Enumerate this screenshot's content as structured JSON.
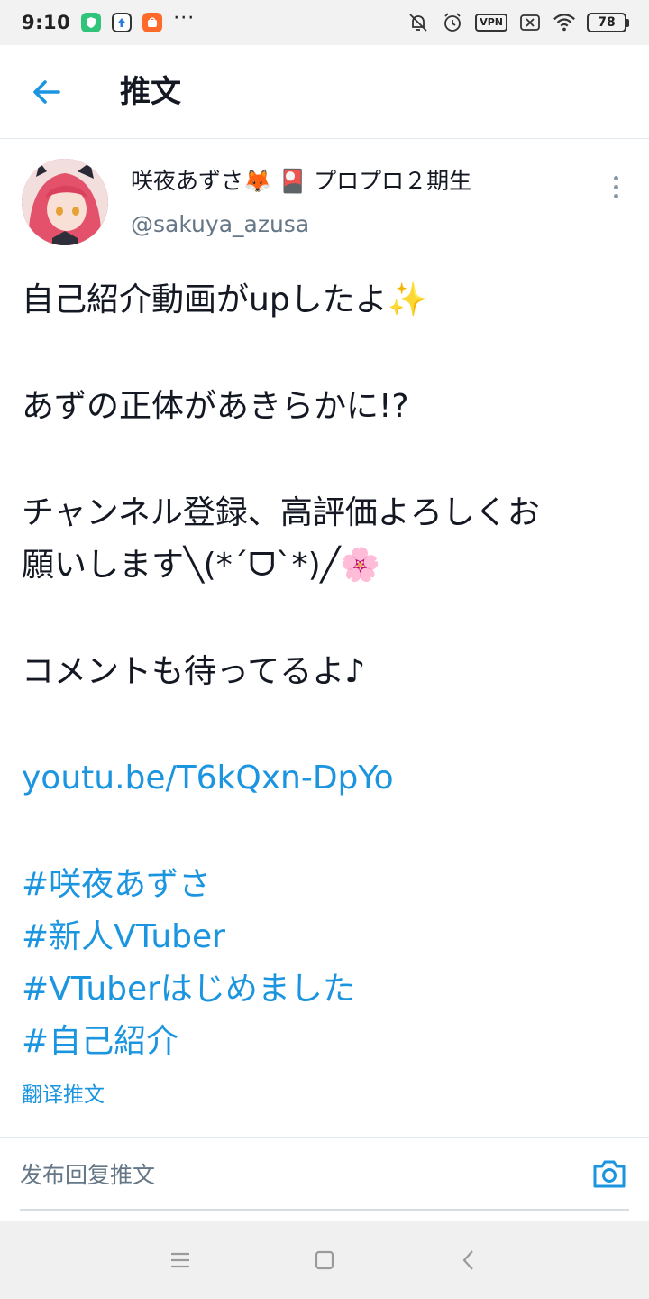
{
  "status_bar": {
    "time": "9:10",
    "battery": "78",
    "vpn_label": "VPN",
    "dots": "···",
    "icons": [
      "shield-app-icon",
      "upload-app-icon",
      "mi-store-icon",
      "bell-off-icon",
      "alarm-icon",
      "vpn-icon",
      "sim-off-icon",
      "wifi-icon",
      "battery-icon"
    ]
  },
  "header": {
    "title": "推文",
    "back_icon": "arrow-left-icon"
  },
  "tweet": {
    "author_name": "咲夜あずさ🦊 🎴 プロプロ２期生",
    "author_handle": "@sakuya_azusa",
    "lines": {
      "l1": "自己紹介動画がupしたよ✨",
      "l2": "あずの正体があきらかに!?",
      "l3": "チャンネル登録、高評価よろしくお",
      "l4": "願いします╲(*´ᗜ`*)╱🌸",
      "l5": "コメントも待ってるよ♪"
    },
    "link": "youtu.be/T6kQxn-DpYo",
    "hashtags": [
      "#咲夜あずさ",
      "#新人VTuber",
      "#VTuberはじめました",
      "#自己紹介"
    ],
    "translate_label": "翻译推文"
  },
  "reply": {
    "placeholder": "发布回复推文"
  },
  "colors": {
    "accent": "#1b95e0",
    "text": "#141823",
    "secondary": "#657786"
  }
}
